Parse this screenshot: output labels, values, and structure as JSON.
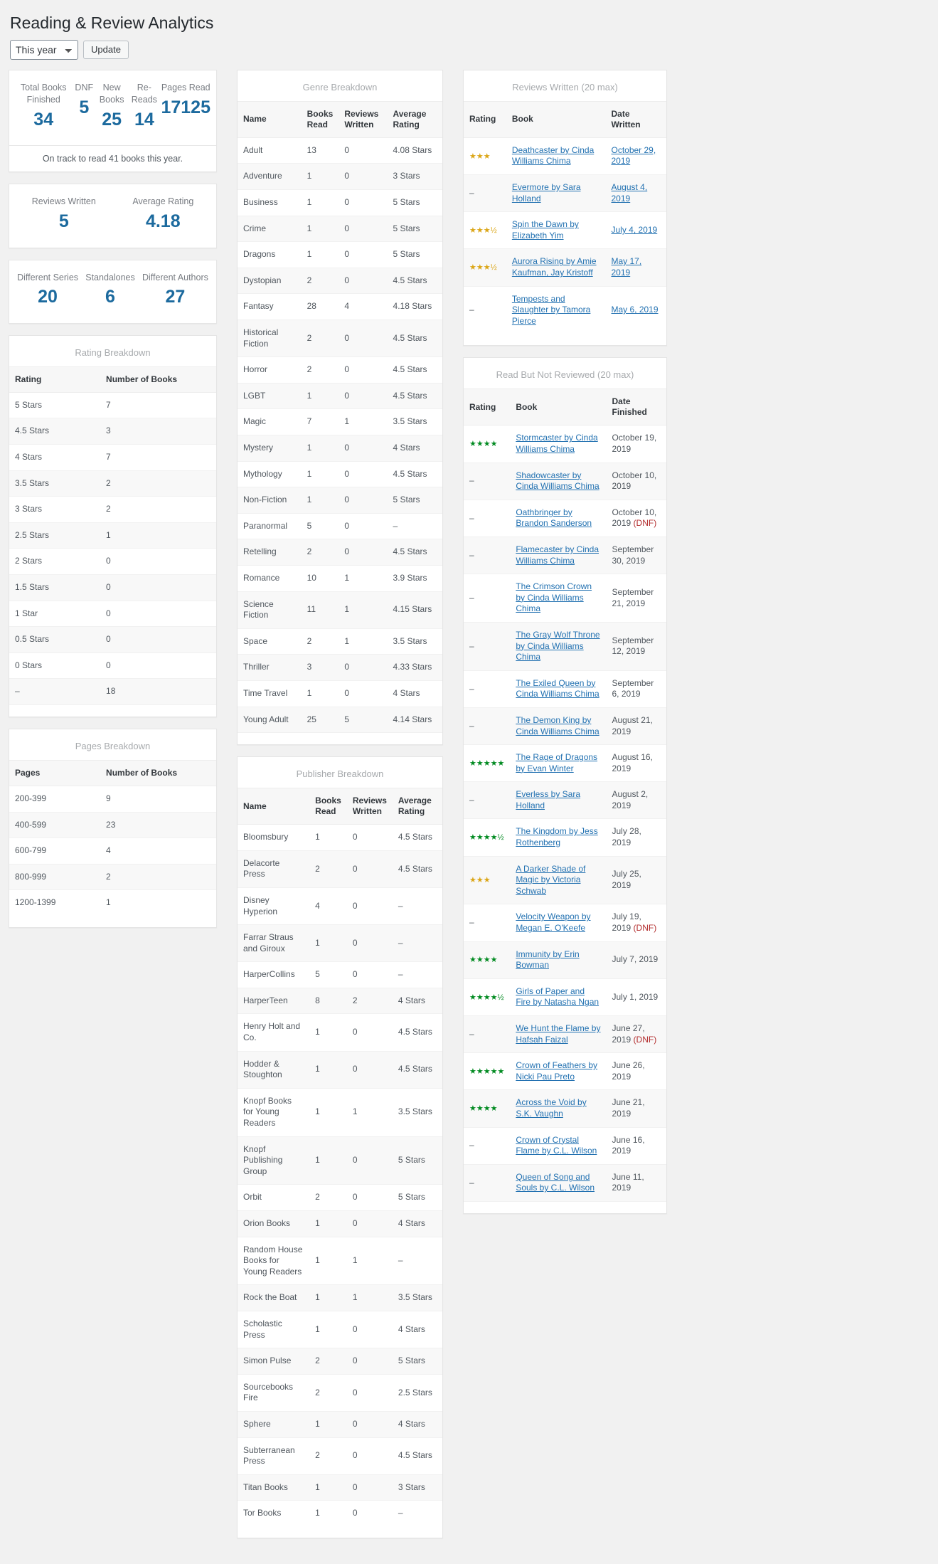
{
  "page": {
    "title": "Reading & Review Analytics",
    "year_select_value": "This year",
    "year_select_options": [
      "This year"
    ],
    "update_label": "Update"
  },
  "summary_primary": {
    "items": [
      {
        "label": "Total Books Finished",
        "value": "34"
      },
      {
        "label": "DNF",
        "value": "5"
      },
      {
        "label": "New Books",
        "value": "25"
      },
      {
        "label": "Re-Reads",
        "value": "14"
      },
      {
        "label": "Pages Read",
        "value": "17125"
      }
    ],
    "note": "On track to read 41 books this year."
  },
  "summary_reviews": {
    "items": [
      {
        "label": "Reviews Written",
        "value": "5"
      },
      {
        "label": "Average Rating",
        "value": "4.18"
      }
    ]
  },
  "summary_series": {
    "items": [
      {
        "label": "Different Series",
        "value": "20"
      },
      {
        "label": "Standalones",
        "value": "6"
      },
      {
        "label": "Different Authors",
        "value": "27"
      }
    ]
  },
  "rating_breakdown": {
    "title": "Rating Breakdown",
    "columns": [
      "Rating",
      "Number of Books"
    ],
    "rows": [
      [
        "5 Stars",
        "7"
      ],
      [
        "4.5 Stars",
        "3"
      ],
      [
        "4 Stars",
        "7"
      ],
      [
        "3.5 Stars",
        "2"
      ],
      [
        "3 Stars",
        "2"
      ],
      [
        "2.5 Stars",
        "1"
      ],
      [
        "2 Stars",
        "0"
      ],
      [
        "1.5 Stars",
        "0"
      ],
      [
        "1 Star",
        "0"
      ],
      [
        "0.5 Stars",
        "0"
      ],
      [
        "0 Stars",
        "0"
      ],
      [
        "–",
        "18"
      ]
    ]
  },
  "pages_breakdown": {
    "title": "Pages Breakdown",
    "columns": [
      "Pages",
      "Number of Books"
    ],
    "rows": [
      [
        "200-399",
        "9"
      ],
      [
        "400-599",
        "23"
      ],
      [
        "600-799",
        "4"
      ],
      [
        "800-999",
        "2"
      ],
      [
        "1200-1399",
        "1"
      ]
    ]
  },
  "genre_breakdown": {
    "title": "Genre Breakdown",
    "columns": [
      "Name",
      "Books Read",
      "Reviews Written",
      "Average Rating"
    ],
    "rows": [
      [
        "Adult",
        "13",
        "0",
        "4.08 Stars"
      ],
      [
        "Adventure",
        "1",
        "0",
        "3 Stars"
      ],
      [
        "Business",
        "1",
        "0",
        "5 Stars"
      ],
      [
        "Crime",
        "1",
        "0",
        "5 Stars"
      ],
      [
        "Dragons",
        "1",
        "0",
        "5 Stars"
      ],
      [
        "Dystopian",
        "2",
        "0",
        "4.5 Stars"
      ],
      [
        "Fantasy",
        "28",
        "4",
        "4.18 Stars"
      ],
      [
        "Historical Fiction",
        "2",
        "0",
        "4.5 Stars"
      ],
      [
        "Horror",
        "2",
        "0",
        "4.5 Stars"
      ],
      [
        "LGBT",
        "1",
        "0",
        "4.5 Stars"
      ],
      [
        "Magic",
        "7",
        "1",
        "3.5 Stars"
      ],
      [
        "Mystery",
        "1",
        "0",
        "4 Stars"
      ],
      [
        "Mythology",
        "1",
        "0",
        "4.5 Stars"
      ],
      [
        "Non-Fiction",
        "1",
        "0",
        "5 Stars"
      ],
      [
        "Paranormal",
        "5",
        "0",
        "–"
      ],
      [
        "Retelling",
        "2",
        "0",
        "4.5 Stars"
      ],
      [
        "Romance",
        "10",
        "1",
        "3.9 Stars"
      ],
      [
        "Science Fiction",
        "11",
        "1",
        "4.15 Stars"
      ],
      [
        "Space",
        "2",
        "1",
        "3.5 Stars"
      ],
      [
        "Thriller",
        "3",
        "0",
        "4.33 Stars"
      ],
      [
        "Time Travel",
        "1",
        "0",
        "4 Stars"
      ],
      [
        "Young Adult",
        "25",
        "5",
        "4.14 Stars"
      ]
    ]
  },
  "publisher_breakdown": {
    "title": "Publisher Breakdown",
    "columns": [
      "Name",
      "Books Read",
      "Reviews Written",
      "Average Rating"
    ],
    "rows": [
      [
        "Bloomsbury",
        "1",
        "0",
        "4.5 Stars"
      ],
      [
        "Delacorte Press",
        "2",
        "0",
        "4.5 Stars"
      ],
      [
        "Disney Hyperion",
        "4",
        "0",
        "–"
      ],
      [
        "Farrar Straus and Giroux",
        "1",
        "0",
        "–"
      ],
      [
        "HarperCollins",
        "5",
        "0",
        "–"
      ],
      [
        "HarperTeen",
        "8",
        "2",
        "4 Stars"
      ],
      [
        "Henry Holt and Co.",
        "1",
        "0",
        "4.5 Stars"
      ],
      [
        "Hodder & Stoughton",
        "1",
        "0",
        "4.5 Stars"
      ],
      [
        "Knopf Books for Young Readers",
        "1",
        "1",
        "3.5 Stars"
      ],
      [
        "Knopf Publishing Group",
        "1",
        "0",
        "5 Stars"
      ],
      [
        "Orbit",
        "2",
        "0",
        "5 Stars"
      ],
      [
        "Orion Books",
        "1",
        "0",
        "4 Stars"
      ],
      [
        "Random House Books for Young Readers",
        "1",
        "1",
        "–"
      ],
      [
        "Rock the Boat",
        "1",
        "1",
        "3.5 Stars"
      ],
      [
        "Scholastic Press",
        "1",
        "0",
        "4 Stars"
      ],
      [
        "Simon Pulse",
        "2",
        "0",
        "5 Stars"
      ],
      [
        "Sourcebooks Fire",
        "2",
        "0",
        "2.5 Stars"
      ],
      [
        "Sphere",
        "1",
        "0",
        "4 Stars"
      ],
      [
        "Subterranean Press",
        "2",
        "0",
        "4.5 Stars"
      ],
      [
        "Titan Books",
        "1",
        "0",
        "3 Stars"
      ],
      [
        "Tor Books",
        "1",
        "0",
        "–"
      ]
    ]
  },
  "reviews_written": {
    "title": "Reviews Written (20 max)",
    "columns": [
      "Rating",
      "Book",
      "Date Written"
    ],
    "star_color": "#dba617",
    "rows": [
      {
        "rating": "★★★",
        "rating_value": 3,
        "book": "Deathcaster by Cinda Williams Chima",
        "date": "October 29, 2019",
        "date_is_link": true
      },
      {
        "rating": "–",
        "rating_value": null,
        "book": "Evermore by Sara Holland",
        "date": "August 4, 2019",
        "date_is_link": true
      },
      {
        "rating": "★★★½",
        "rating_value": 3.5,
        "book": "Spin the Dawn by Elizabeth Yim",
        "date": "July 4, 2019",
        "date_is_link": true
      },
      {
        "rating": "★★★½",
        "rating_value": 3.5,
        "book": "Aurora Rising by Amie Kaufman, Jay Kristoff",
        "date": "May 17, 2019",
        "date_is_link": true
      },
      {
        "rating": "–",
        "rating_value": null,
        "book": "Tempests and Slaughter by Tamora Pierce",
        "date": "May 6, 2019",
        "date_is_link": true
      }
    ]
  },
  "read_not_reviewed": {
    "title": "Read But Not Reviewed (20 max)",
    "columns": [
      "Rating",
      "Book",
      "Date Finished"
    ],
    "star_color": "#008a20",
    "dnf_color": "#b32d2e",
    "dnf_label": "(DNF)",
    "rows": [
      {
        "rating": "★★★★",
        "rating_value": 4,
        "star_color": "green",
        "book": "Stormcaster by Cinda Williams Chima",
        "date": "October 19, 2019",
        "dnf": false
      },
      {
        "rating": "–",
        "rating_value": null,
        "star_color": "green",
        "book": "Shadowcaster by Cinda Williams Chima",
        "date": "October 10, 2019",
        "dnf": false
      },
      {
        "rating": "–",
        "rating_value": null,
        "star_color": "green",
        "book": "Oathbringer by Brandon Sanderson",
        "date": "October 10, 2019",
        "dnf": true
      },
      {
        "rating": "–",
        "rating_value": null,
        "star_color": "green",
        "book": "Flamecaster by Cinda Williams Chima",
        "date": "September 30, 2019",
        "dnf": false
      },
      {
        "rating": "–",
        "rating_value": null,
        "star_color": "green",
        "book": "The Crimson Crown by Cinda Williams Chima",
        "date": "September 21, 2019",
        "dnf": false
      },
      {
        "rating": "–",
        "rating_value": null,
        "star_color": "green",
        "book": "The Gray Wolf Throne by Cinda Williams Chima",
        "date": "September 12, 2019",
        "dnf": false
      },
      {
        "rating": "–",
        "rating_value": null,
        "star_color": "green",
        "book": "The Exiled Queen by Cinda Williams Chima",
        "date": "September 6, 2019",
        "dnf": false
      },
      {
        "rating": "–",
        "rating_value": null,
        "star_color": "green",
        "book": "The Demon King by Cinda Williams Chima",
        "date": "August 21, 2019",
        "dnf": false
      },
      {
        "rating": "★★★★★",
        "rating_value": 5,
        "star_color": "green",
        "book": "The Rage of Dragons by Evan Winter",
        "date": "August 16, 2019",
        "dnf": false
      },
      {
        "rating": "–",
        "rating_value": null,
        "star_color": "green",
        "book": "Everless by Sara Holland",
        "date": "August 2, 2019",
        "dnf": false
      },
      {
        "rating": "★★★★½",
        "rating_value": 4.5,
        "star_color": "green",
        "book": "The Kingdom by Jess Rothenberg",
        "date": "July 28, 2019",
        "dnf": false
      },
      {
        "rating": "★★★",
        "rating_value": 3,
        "star_color": "gold",
        "book": "A Darker Shade of Magic by Victoria Schwab",
        "date": "July 25, 2019",
        "dnf": false
      },
      {
        "rating": "–",
        "rating_value": null,
        "star_color": "green",
        "book": "Velocity Weapon by Megan E. O'Keefe",
        "date": "July 19, 2019",
        "dnf": true
      },
      {
        "rating": "★★★★",
        "rating_value": 4,
        "star_color": "green",
        "book": "Immunity by Erin Bowman",
        "date": "July 7, 2019",
        "dnf": false
      },
      {
        "rating": "★★★★½",
        "rating_value": 4.5,
        "star_color": "green",
        "book": "Girls of Paper and Fire by Natasha Ngan",
        "date": "July 1, 2019",
        "dnf": false
      },
      {
        "rating": "–",
        "rating_value": null,
        "star_color": "green",
        "book": "We Hunt the Flame by Hafsah Faizal",
        "date": "June 27, 2019",
        "dnf": true
      },
      {
        "rating": "★★★★★",
        "rating_value": 5,
        "star_color": "green",
        "book": "Crown of Feathers by Nicki Pau Preto",
        "date": "June 26, 2019",
        "dnf": false
      },
      {
        "rating": "★★★★",
        "rating_value": 4,
        "star_color": "green",
        "book": "Across the Void by S.K. Vaughn",
        "date": "June 21, 2019",
        "dnf": false
      },
      {
        "rating": "–",
        "rating_value": null,
        "star_color": "green",
        "book": "Crown of Crystal Flame by C.L. Wilson",
        "date": "June 16, 2019",
        "dnf": false
      },
      {
        "rating": "–",
        "rating_value": null,
        "star_color": "green",
        "book": "Queen of Song and Souls by C.L. Wilson",
        "date": "June 11, 2019",
        "dnf": false
      }
    ]
  }
}
